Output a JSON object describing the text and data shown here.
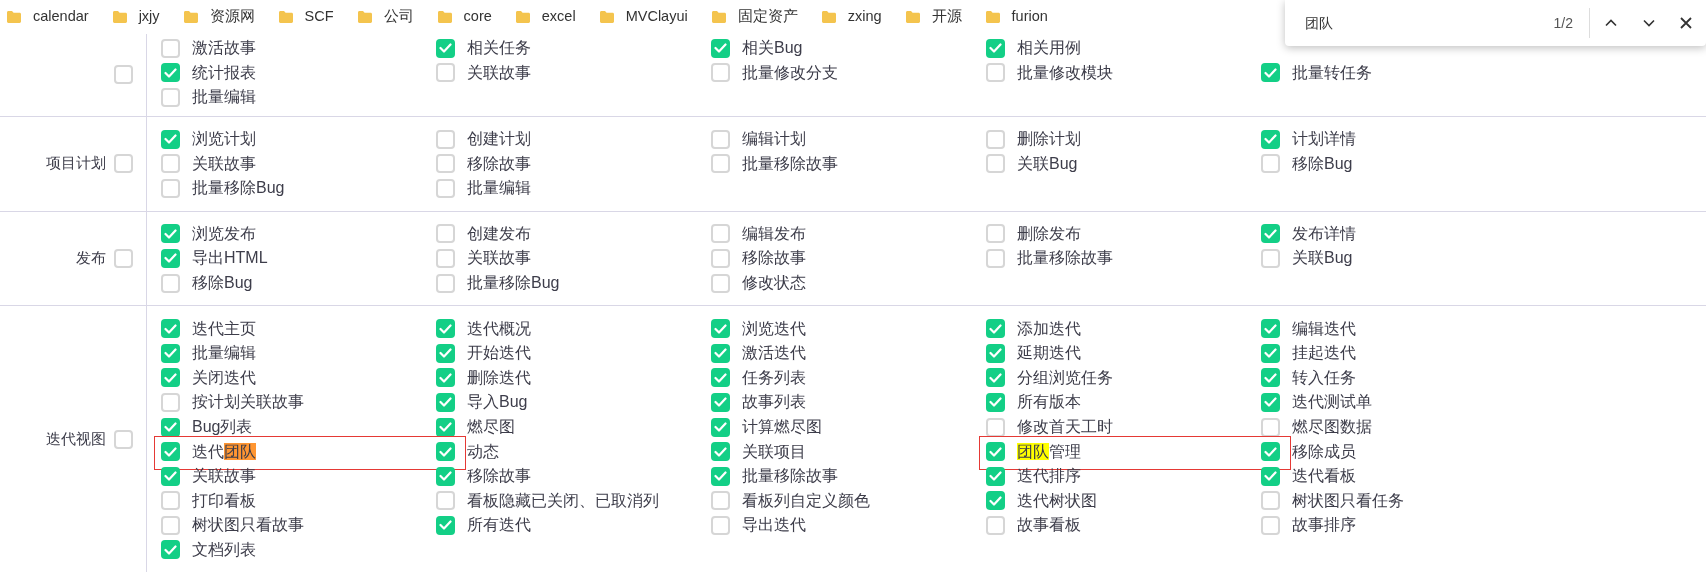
{
  "bookmarks": [
    {
      "label": "calendar"
    },
    {
      "label": "jxjy"
    },
    {
      "label": "资源网"
    },
    {
      "label": "SCF"
    },
    {
      "label": "公司"
    },
    {
      "label": "core"
    },
    {
      "label": "excel"
    },
    {
      "label": "MVClayui"
    },
    {
      "label": "固定资产"
    },
    {
      "label": "zxing"
    },
    {
      "label": "开源"
    },
    {
      "label": "furion"
    }
  ],
  "find_bar": {
    "query": "团队",
    "count": "1/2"
  },
  "sections": [
    {
      "checked": false,
      "rows": [
        [
          {
            "label": "激活故事",
            "checked": false
          },
          {
            "label": "相关任务",
            "checked": true
          },
          {
            "label": "相关Bug",
            "checked": true
          },
          {
            "label": "相关用例",
            "checked": true
          }
        ],
        [
          {
            "label": "统计报表",
            "checked": true
          },
          {
            "label": "关联故事",
            "checked": false
          },
          {
            "label": "批量修改分支",
            "checked": false
          },
          {
            "label": "批量修改模块",
            "checked": false
          },
          {
            "label": "批量转任务",
            "checked": true
          }
        ],
        [
          {
            "label": "批量编辑",
            "checked": false
          }
        ]
      ]
    },
    {
      "label": "项目计划",
      "checked": false,
      "rows": [
        [
          {
            "label": "浏览计划",
            "checked": true
          },
          {
            "label": "创建计划",
            "checked": false
          },
          {
            "label": "编辑计划",
            "checked": false
          },
          {
            "label": "删除计划",
            "checked": false
          },
          {
            "label": "计划详情",
            "checked": true
          }
        ],
        [
          {
            "label": "关联故事",
            "checked": false
          },
          {
            "label": "移除故事",
            "checked": false
          },
          {
            "label": "批量移除故事",
            "checked": false
          },
          {
            "label": "关联Bug",
            "checked": false
          },
          {
            "label": "移除Bug",
            "checked": false
          }
        ],
        [
          {
            "label": "批量移除Bug",
            "checked": false
          },
          {
            "label": "批量编辑",
            "checked": false
          }
        ]
      ]
    },
    {
      "label": "发布",
      "checked": false,
      "rows": [
        [
          {
            "label": "浏览发布",
            "checked": true
          },
          {
            "label": "创建发布",
            "checked": false
          },
          {
            "label": "编辑发布",
            "checked": false
          },
          {
            "label": "删除发布",
            "checked": false
          },
          {
            "label": "发布详情",
            "checked": true
          }
        ],
        [
          {
            "label": "导出HTML",
            "checked": true
          },
          {
            "label": "关联故事",
            "checked": false
          },
          {
            "label": "移除故事",
            "checked": false
          },
          {
            "label": "批量移除故事",
            "checked": false
          },
          {
            "label": "关联Bug",
            "checked": false
          }
        ],
        [
          {
            "label": "移除Bug",
            "checked": false
          },
          {
            "label": "批量移除Bug",
            "checked": false
          },
          {
            "label": "修改状态",
            "checked": false
          }
        ]
      ]
    },
    {
      "label": "迭代视图",
      "checked": false,
      "rows": [
        [
          {
            "label": "迭代主页",
            "checked": true
          },
          {
            "label": "迭代概况",
            "checked": true
          },
          {
            "label": "浏览迭代",
            "checked": true
          },
          {
            "label": "添加迭代",
            "checked": true
          },
          {
            "label": "编辑迭代",
            "checked": true
          }
        ],
        [
          {
            "label": "批量编辑",
            "checked": true
          },
          {
            "label": "开始迭代",
            "checked": true
          },
          {
            "label": "激活迭代",
            "checked": true
          },
          {
            "label": "延期迭代",
            "checked": true
          },
          {
            "label": "挂起迭代",
            "checked": true
          }
        ],
        [
          {
            "label": "关闭迭代",
            "checked": true
          },
          {
            "label": "删除迭代",
            "checked": true
          },
          {
            "label": "任务列表",
            "checked": true
          },
          {
            "label": "分组浏览任务",
            "checked": true
          },
          {
            "label": "转入任务",
            "checked": true
          }
        ],
        [
          {
            "label": "按计划关联故事",
            "checked": false
          },
          {
            "label": "导入Bug",
            "checked": true
          },
          {
            "label": "故事列表",
            "checked": true
          },
          {
            "label": "所有版本",
            "checked": true
          },
          {
            "label": "迭代测试单",
            "checked": true
          }
        ],
        [
          {
            "label": "Bug列表",
            "checked": true
          },
          {
            "label": "燃尽图",
            "checked": true
          },
          {
            "label": "计算燃尽图",
            "checked": true
          },
          {
            "label": "修改首天工时",
            "checked": false
          },
          {
            "label": "燃尽图数据",
            "checked": false
          }
        ],
        [
          {
            "segments": [
              {
                "text": "迭代",
                "highlighted": false
              },
              {
                "text": "团队",
                "highlighted": true,
                "current": true
              }
            ],
            "checked": true,
            "annotated": true
          },
          {
            "label": "动态",
            "checked": true
          },
          {
            "label": "关联项目",
            "checked": true
          },
          {
            "segments": [
              {
                "text": "团队",
                "highlighted": true,
                "current": false
              },
              {
                "text": "管理",
                "highlighted": false
              }
            ],
            "checked": true,
            "annotated": true
          },
          {
            "label": "移除成员",
            "checked": true
          }
        ],
        [
          {
            "label": "关联故事",
            "checked": true
          },
          {
            "label": "移除故事",
            "checked": true
          },
          {
            "label": "批量移除故事",
            "checked": true
          },
          {
            "label": "迭代排序",
            "checked": true
          },
          {
            "label": "迭代看板",
            "checked": true
          }
        ],
        [
          {
            "label": "打印看板",
            "checked": false
          },
          {
            "label": "看板隐藏已关闭、已取消列",
            "checked": false
          },
          {
            "label": "看板列自定义颜色",
            "checked": false
          },
          {
            "label": "迭代树状图",
            "checked": true
          },
          {
            "label": "树状图只看任务",
            "checked": false
          }
        ],
        [
          {
            "label": "树状图只看故事",
            "checked": false
          },
          {
            "label": "所有迭代",
            "checked": true
          },
          {
            "label": "导出迭代",
            "checked": false
          },
          {
            "label": "故事看板",
            "checked": false
          },
          {
            "label": "故事排序",
            "checked": false
          }
        ],
        [
          {
            "label": "文档列表",
            "checked": true
          }
        ]
      ]
    }
  ]
}
